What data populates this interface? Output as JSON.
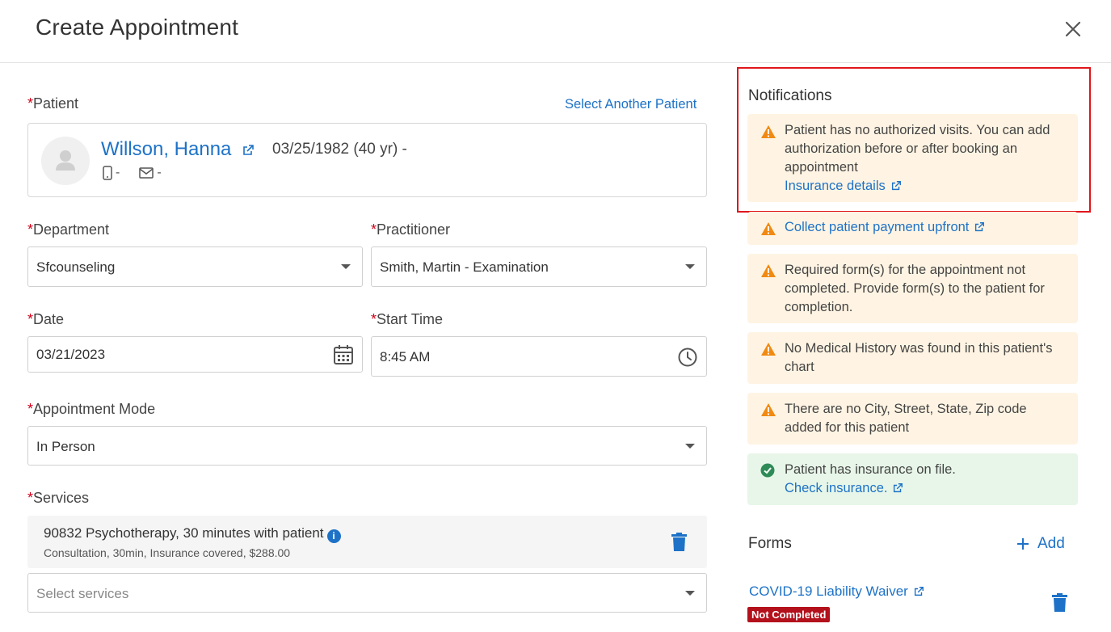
{
  "header": {
    "title": "Create Appointment"
  },
  "patient": {
    "label": "Patient",
    "select_another": "Select Another Patient",
    "name": "Willson, Hanna",
    "dob": "03/25/1982 (40 yr) -",
    "phone": "-",
    "email": "-"
  },
  "department": {
    "label": "Department",
    "value": "Sfcounseling"
  },
  "practitioner": {
    "label": "Practitioner",
    "value": "Smith, Martin - Examination"
  },
  "date": {
    "label": "Date",
    "value": "03/21/2023"
  },
  "start_time": {
    "label": "Start Time",
    "value": "8:45 AM"
  },
  "mode": {
    "label": "Appointment Mode",
    "value": "In Person"
  },
  "services": {
    "label": "Services",
    "item_name": "90832 Psychotherapy, 30 minutes with patient",
    "item_meta": "Consultation, 30min, Insurance covered, $288.00",
    "placeholder": "Select services"
  },
  "notifications": {
    "title": "Notifications",
    "items": [
      {
        "text": "Patient has no authorized visits. You can add authorization before or after booking an appointment",
        "link": "Insurance details"
      },
      {
        "link": "Collect patient payment upfront"
      },
      {
        "text": "Required form(s) for the appointment not completed. Provide form(s) to the patient for completion."
      },
      {
        "text": "No Medical History was found in this patient's chart"
      },
      {
        "text": "There are no City, Street, State, Zip code added for this patient"
      },
      {
        "text": "Patient has insurance on file.",
        "link": "Check insurance."
      }
    ]
  },
  "forms": {
    "title": "Forms",
    "add_label": "Add",
    "item_name": "COVID-19 Liability Waiver",
    "item_status": "Not Completed"
  },
  "colors": {
    "accent": "#1d72c7",
    "warning_bg": "#fff4e3",
    "success_bg": "#e7f6e8",
    "required": "#d0021b",
    "badge": "#b3111b"
  }
}
